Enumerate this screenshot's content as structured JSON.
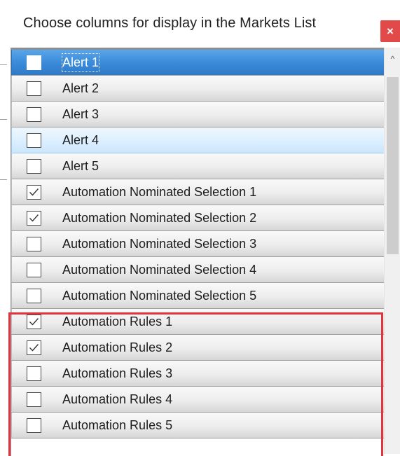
{
  "dialog": {
    "title": "Choose columns for display in the Markets List",
    "close_label": "×",
    "close_icon": "close-icon"
  },
  "columns": [
    {
      "label": "Alert 1",
      "checked": false,
      "state": "selected"
    },
    {
      "label": "Alert 2",
      "checked": false,
      "state": "normal"
    },
    {
      "label": "Alert 3",
      "checked": false,
      "state": "normal"
    },
    {
      "label": "Alert 4",
      "checked": false,
      "state": "hover"
    },
    {
      "label": "Alert 5",
      "checked": false,
      "state": "normal"
    },
    {
      "label": "Automation Nominated Selection 1",
      "checked": true,
      "state": "normal"
    },
    {
      "label": "Automation Nominated Selection 2",
      "checked": true,
      "state": "normal"
    },
    {
      "label": "Automation Nominated Selection 3",
      "checked": false,
      "state": "normal"
    },
    {
      "label": "Automation Nominated Selection 4",
      "checked": false,
      "state": "normal"
    },
    {
      "label": "Automation Nominated Selection 5",
      "checked": false,
      "state": "normal"
    },
    {
      "label": "Automation Rules 1",
      "checked": true,
      "state": "normal"
    },
    {
      "label": "Automation Rules 2",
      "checked": true,
      "state": "normal"
    },
    {
      "label": "Automation Rules 3",
      "checked": false,
      "state": "normal"
    },
    {
      "label": "Automation Rules 4",
      "checked": false,
      "state": "normal"
    },
    {
      "label": "Automation Rules 5",
      "checked": false,
      "state": "normal"
    }
  ],
  "scrollbar": {
    "up_icon": "chevron-up-icon",
    "up_glyph": "^"
  },
  "colors": {
    "selected_row": "#3e8edc",
    "hover_row": "#dcefff",
    "highlight_border": "#e0353f",
    "close_button": "#e24a4a"
  }
}
